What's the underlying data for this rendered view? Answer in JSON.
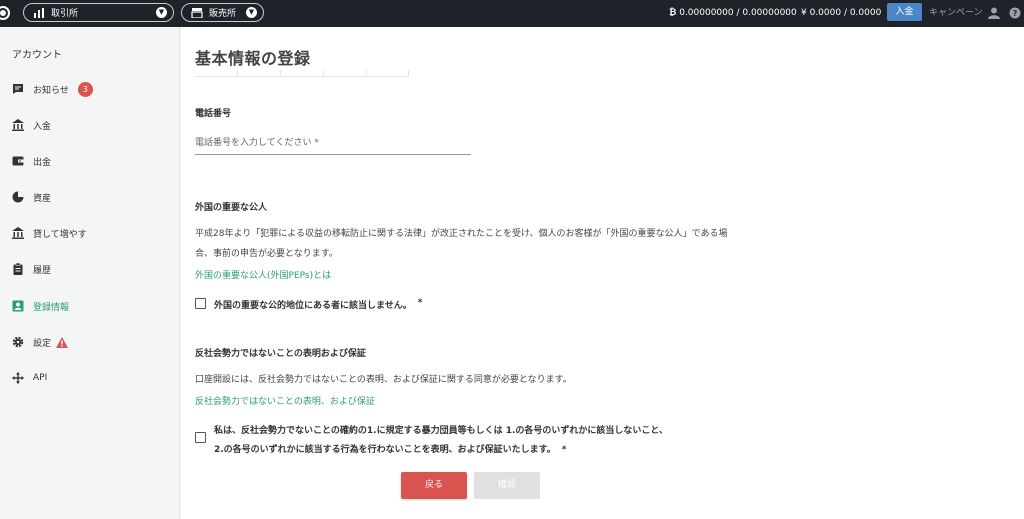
{
  "topbar": {
    "exchange_label": "取引所",
    "store_label": "販売所",
    "btc_balance": "0.00000000 / 0.00000000",
    "jpy_balance": "¥ 0.0000 / 0.0000",
    "deposit_label": "入金",
    "campaign_label": "キャンペーン"
  },
  "sidebar": {
    "title": "アカウント",
    "items": [
      {
        "label": "お知らせ",
        "icon": "message-icon",
        "badge": "3"
      },
      {
        "label": "入金",
        "icon": "bank-icon"
      },
      {
        "label": "出金",
        "icon": "wallet-icon"
      },
      {
        "label": "資産",
        "icon": "pie-chart-icon"
      },
      {
        "label": "貸して増やす",
        "icon": "bank-icon"
      },
      {
        "label": "履歴",
        "icon": "clipboard-icon"
      },
      {
        "label": "登録情報",
        "icon": "id-card-icon"
      },
      {
        "label": "設定",
        "icon": "gear-icon"
      },
      {
        "label": "API",
        "icon": "move-icon"
      }
    ]
  },
  "main": {
    "title": "基本情報の登録",
    "phone": {
      "heading": "電話番号",
      "placeholder": "電話番号を入力してください *"
    },
    "peps": {
      "heading": "外国の重要な公人",
      "description": "平成28年より「犯罪による収益の移転防止に関する法律」が改正されたことを受け、個人のお客様が「外国の重要な公人」である場合、事前の申告が必要となります。",
      "link": "外国の重要な公人(外国PEPs)とは",
      "checkbox": "外国の重要な公的地位にある者に該当しません。",
      "required_mark": "*"
    },
    "antisocial": {
      "heading": "反社会勢力ではないことの表明および保証",
      "description": "口座開設には、反社会勢力ではないことの表明、および保証に関する同意が必要となります。",
      "link": "反社会勢力ではないことの表明、および保証",
      "checkbox_line1": "私は、反社会勢力でないことの確約の1.に規定する暴力団員等もしくは 1.の各号のいずれかに該当しないこと、",
      "checkbox_line2": "2.の各号のいずれかに該当する行為を行わないことを表明、および保証いたします。",
      "required_mark": "*"
    },
    "buttons": {
      "back": "戻る",
      "confirm": "確認"
    }
  },
  "colors": {
    "topbar_bg": "#1e2229",
    "accent_green": "#2e9c7a",
    "danger_red": "#d9534f",
    "deposit_blue": "#4c86c7"
  }
}
